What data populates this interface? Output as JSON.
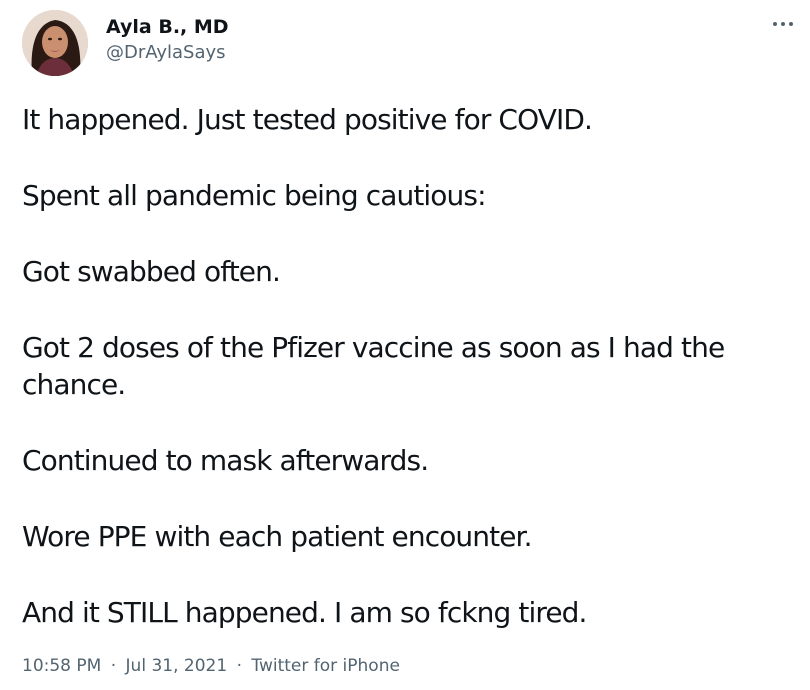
{
  "author": {
    "display_name": "Ayla B., MD",
    "handle": "@DrAylaSays",
    "avatar_icon": "profile-photo"
  },
  "menu": {
    "more_icon": "more-horizontal-icon"
  },
  "tweet": {
    "paragraphs": [
      "It happened. Just tested positive for COVID.",
      "Spent all pandemic being cautious:",
      "Got swabbed often.",
      "Got 2 doses of the Pfizer vaccine as soon as I had the chance.",
      "Continued to mask afterwards.",
      "Wore PPE with each patient encounter.",
      "And it STILL happened. I am so fckng tired."
    ]
  },
  "meta": {
    "time": "10:58 PM",
    "separator": "·",
    "date": "Jul 31, 2021",
    "source": "Twitter for iPhone"
  },
  "colors": {
    "text_primary": "#0f1419",
    "text_secondary": "#536471",
    "background": "#ffffff"
  }
}
